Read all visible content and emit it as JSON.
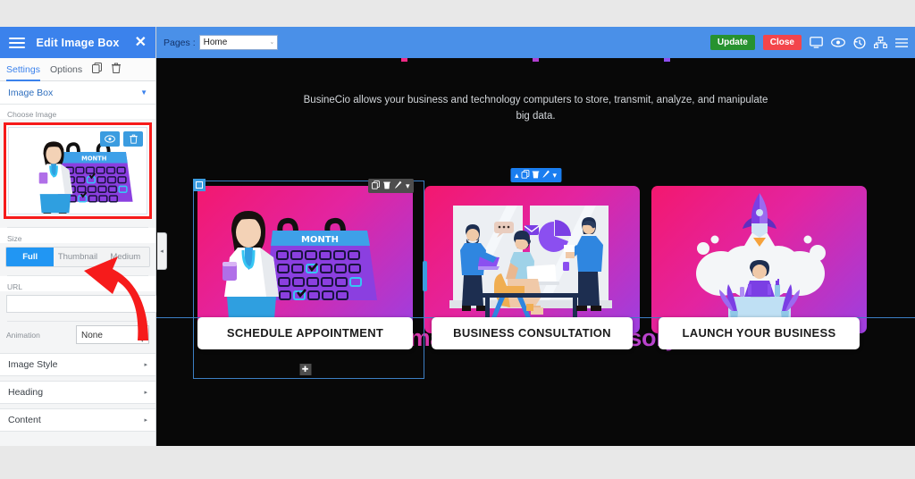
{
  "panel": {
    "title": "Edit Image Box",
    "burger_icon": "hamburger-icon",
    "close_icon": "close-icon",
    "tabs": [
      {
        "label": "Settings",
        "active": true
      },
      {
        "label": "Options",
        "active": false
      }
    ],
    "tab_icons": [
      {
        "name": "copy-icon",
        "glyph": "❐"
      },
      {
        "name": "trash-icon",
        "glyph": "🗑"
      }
    ],
    "widget_accordion": {
      "label": "Image Box",
      "caret": "▼"
    },
    "choose_image": {
      "label": "Choose Image"
    },
    "thumb_buttons": [
      {
        "name": "preview-image-button",
        "glyph": "👁"
      },
      {
        "name": "delete-image-button",
        "glyph": "🗑"
      }
    ],
    "size": {
      "label": "Size",
      "options": [
        "Full",
        "Thumbnail",
        "Medium"
      ],
      "selected": "Full"
    },
    "url": {
      "label": "URL",
      "value": "",
      "add_glyph": "+"
    },
    "animation": {
      "label": "Animation",
      "value": "None",
      "caret": "▾"
    },
    "sections": [
      {
        "label": "Image Style",
        "caret": "▸"
      },
      {
        "label": "Heading",
        "caret": "▸"
      },
      {
        "label": "Content",
        "caret": "▸"
      }
    ],
    "collapse_glyph": "◂"
  },
  "topbar": {
    "pages_label": "Pages :",
    "page_value": "Home",
    "page_caret": "ˇ",
    "update_label": "Update",
    "close_label": "Close",
    "icons": [
      {
        "name": "responsive-view-icon",
        "glyph": "🖵"
      },
      {
        "name": "preview-icon",
        "glyph": "👁"
      },
      {
        "name": "revision-history-icon",
        "glyph": "↺"
      },
      {
        "name": "structure-icon",
        "glyph": "⨁"
      },
      {
        "name": "menu-icon",
        "glyph": "☰"
      }
    ]
  },
  "canvas": {
    "subtitle": "BusineCio allows your business and technology computers to store, transmit, analyze, and manipulate big data.",
    "section_toolbar": [
      {
        "name": "move-section-icon",
        "glyph": "▴"
      },
      {
        "name": "duplicate-section-icon",
        "glyph": "❐"
      },
      {
        "name": "delete-section-icon",
        "glyph": "🗑"
      },
      {
        "name": "edit-section-icon",
        "glyph": "✎"
      },
      {
        "name": "more-section-icon",
        "glyph": "▾"
      }
    ],
    "widget_toolbar": [
      {
        "name": "duplicate-widget-icon",
        "glyph": "❐"
      },
      {
        "name": "delete-widget-icon",
        "glyph": "🗑"
      },
      {
        "name": "edit-widget-icon",
        "glyph": "✎"
      },
      {
        "name": "more-widget-icon",
        "glyph": "▾"
      }
    ],
    "add_widget_glyph": "✚",
    "cards": [
      {
        "label": "SCHEDULE APPOINTMENT",
        "illustration": "doctor-calendar-illustration"
      },
      {
        "label": "BUSINESS CONSULTATION",
        "illustration": "office-meeting-illustration"
      },
      {
        "label": "LAUNCH YOUR BUSINESS",
        "illustration": "rocket-launch-illustration"
      }
    ],
    "bottom_heading": "Smart Business Advisory"
  },
  "colors": {
    "panel_header": "#3b82ec",
    "topbar": "#4a90e8",
    "update_button": "#27922f",
    "close_button": "#f3454b",
    "canvas_bg": "#080808",
    "card_gradient_start": "#f3186f",
    "card_gradient_end": "#9d3fe0",
    "selection_outline": "#3c7fc4",
    "annotation_arrow": "#f61b1b",
    "thumb_highlight": "#f61b1b"
  }
}
